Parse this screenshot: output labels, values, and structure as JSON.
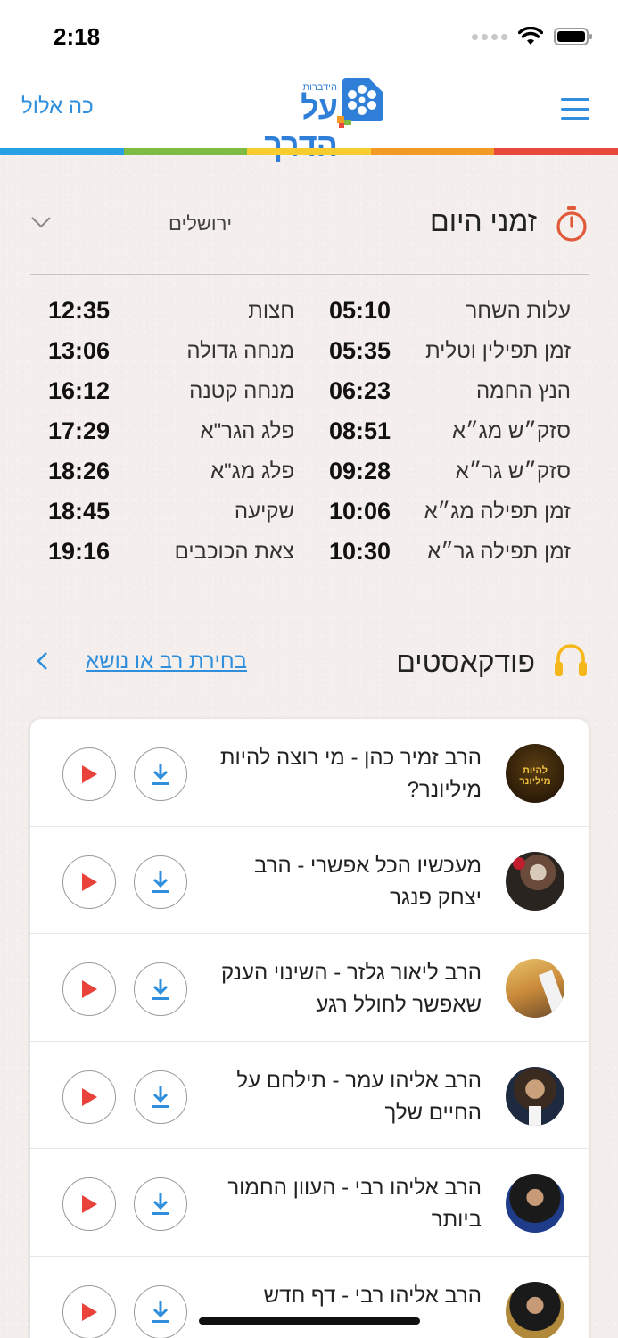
{
  "status": {
    "time": "2:18"
  },
  "header": {
    "date": "כה אלול",
    "logo_title": "על הדרך",
    "logo_sub": "הידברות"
  },
  "colors": {
    "accent": "#2f8fdc",
    "rainbow": [
      "#2aa0e4",
      "#7dbb42",
      "#f6cc2e",
      "#f39a24",
      "#e9483c"
    ]
  },
  "zmanim": {
    "title": "זמני היום",
    "city": "ירושלים",
    "rows": [
      {
        "right_label": "עלות השחר",
        "right_value": "05:10",
        "left_label": "חצות",
        "left_value": "12:35"
      },
      {
        "right_label": "זמן תפילין וטלית",
        "right_value": "05:35",
        "left_label": "מנחה גדולה",
        "left_value": "13:06"
      },
      {
        "right_label": "הנץ החמה",
        "right_value": "06:23",
        "left_label": "מנחה קטנה",
        "left_value": "16:12"
      },
      {
        "right_label": "סזק״ש מג״א",
        "right_value": "08:51",
        "left_label": "פלג הגר\"א",
        "left_value": "17:29"
      },
      {
        "right_label": "סזק״ש גר״א",
        "right_value": "09:28",
        "left_label": "פלג מג\"א",
        "left_value": "18:26"
      },
      {
        "right_label": "זמן תפילה מג״א",
        "right_value": "10:06",
        "left_label": "שקיעה",
        "left_value": "18:45"
      },
      {
        "right_label": "זמן תפילה גר״א",
        "right_value": "10:30",
        "left_label": "צאת הכוכבים",
        "left_value": "19:16"
      }
    ]
  },
  "podcasts": {
    "title": "פודקאסטים",
    "link": "בחירת רב או נושא",
    "items": [
      {
        "title": "הרב זמיר כהן - מי רוצה להיות מיליונר?",
        "avatar_text": "להיות מיליונר"
      },
      {
        "title": "מעכשיו הכל אפשרי - הרב יצחק פנגר"
      },
      {
        "title": "הרב ליאור גלזר - השינוי הענק שאפשר לחולל רגע"
      },
      {
        "title": "הרב אליהו עמר - תילחם על החיים שלך"
      },
      {
        "title": "הרב אליהו רבי - העוון החמור ביותר"
      },
      {
        "title": "הרב אליהו רבי - דף חדש"
      }
    ]
  }
}
